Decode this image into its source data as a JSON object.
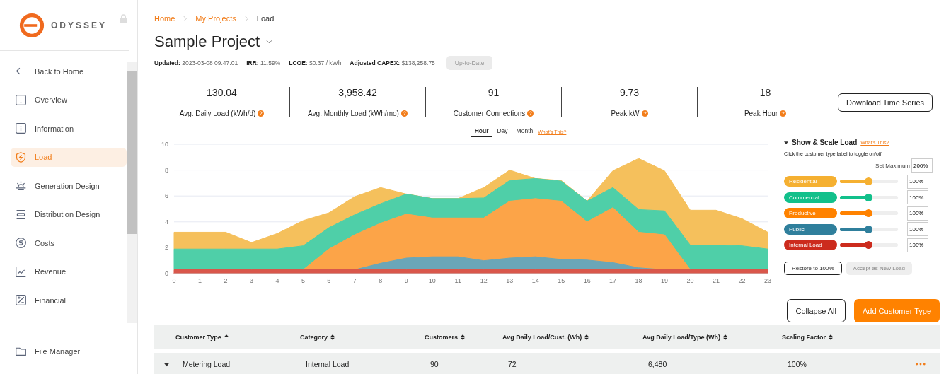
{
  "brand": {
    "name": "ODYSSEY"
  },
  "sidebar": {
    "items": [
      {
        "label": "Back to Home",
        "selected": false
      },
      {
        "label": "Overview",
        "selected": false
      },
      {
        "label": "Information",
        "selected": false
      },
      {
        "label": "Load",
        "selected": true
      },
      {
        "label": "Generation Design",
        "selected": false
      },
      {
        "label": "Distribution Design",
        "selected": false
      },
      {
        "label": "Costs",
        "selected": false
      },
      {
        "label": "Revenue",
        "selected": false
      },
      {
        "label": "Financial",
        "selected": false
      }
    ],
    "footer_item": {
      "label": "File Manager"
    }
  },
  "breadcrumb": [
    {
      "label": "Home",
      "link": true
    },
    {
      "label": "My Projects",
      "link": true
    },
    {
      "label": "Load",
      "link": false
    }
  ],
  "project": {
    "title": "Sample Project",
    "meta": [
      {
        "label": "Updated:",
        "value": "2023-03-08 09:47:01"
      },
      {
        "label": "IRR:",
        "value": "11.59%"
      },
      {
        "label": "LCOE:",
        "value": "$0.37 / kWh"
      },
      {
        "label": "Adjusted CAPEX:",
        "value": "$138,258.75"
      }
    ],
    "status_button": "Up-to-Date"
  },
  "stats": [
    {
      "value": "130.04",
      "label": "Avg. Daily Load (kWh/d)"
    },
    {
      "value": "3,958.42",
      "label": "Avg. Monthly Load (kWh/mo)"
    },
    {
      "value": "91",
      "label": "Customer Connections"
    },
    {
      "value": "9.73",
      "label": "Peak kW"
    },
    {
      "value": "18",
      "label": "Peak Hour"
    }
  ],
  "download_button": "Download Time Series",
  "period_tabs": [
    {
      "label": "Hour",
      "selected": true
    },
    {
      "label": "Day",
      "selected": false
    },
    {
      "label": "Month",
      "selected": false
    }
  ],
  "whats_this": "What's This?",
  "chart": {
    "chart_data": {
      "type": "area",
      "stacked": true,
      "grid": true,
      "xlim": [
        0,
        23
      ],
      "x": [
        0,
        1,
        2,
        3,
        4,
        5,
        6,
        7,
        8,
        9,
        10,
        11,
        12,
        13,
        14,
        15,
        16,
        17,
        18,
        19,
        20,
        21,
        22,
        23
      ],
      "xticks": [
        0,
        1,
        2,
        3,
        4,
        5,
        6,
        7,
        8,
        9,
        10,
        11,
        12,
        13,
        14,
        15,
        16,
        17,
        18,
        19,
        20,
        21,
        22,
        23
      ],
      "ylim": [
        0,
        10
      ],
      "yticks": [
        0,
        2,
        4,
        6,
        8,
        10
      ],
      "series": [
        {
          "color": "#f5c05c",
          "values": [
            1.3,
            1.3,
            1.3,
            0.5,
            1.2,
            1.95,
            1.15,
            1.4,
            1.25,
            0,
            0,
            0,
            0.8,
            0.8,
            0,
            0.05,
            0,
            1.3,
            3.95,
            3.1,
            2.7,
            2.7,
            2.1,
            1.3
          ]
        },
        {
          "color": "#4fcfa8",
          "values": [
            1.6,
            1.6,
            1.6,
            1.6,
            1.6,
            1.85,
            1.65,
            1.55,
            1.5,
            1.55,
            1.5,
            1.5,
            1.55,
            1.6,
            1.55,
            1.55,
            1.6,
            1.55,
            1.75,
            1.85,
            1.9,
            1.9,
            1.85,
            1.6
          ]
        },
        {
          "color": "#fca448",
          "values": [
            0,
            0,
            0,
            0,
            0,
            0,
            1.6,
            2.7,
            3.1,
            3.4,
            3.0,
            3.0,
            3.3,
            4.4,
            4.5,
            4.5,
            2.95,
            4.25,
            2.75,
            2.7,
            0,
            0,
            0,
            0
          ]
        },
        {
          "color": "#6aa6b8",
          "values": [
            0,
            0,
            0,
            0,
            0,
            0,
            0,
            0,
            0.5,
            0.9,
            1.0,
            1.0,
            0.7,
            0.9,
            1.0,
            0.8,
            0.75,
            0.55,
            0.15,
            0,
            0,
            0,
            0,
            0
          ]
        },
        {
          "color": "#d9574b",
          "values": [
            0.3,
            0.3,
            0.3,
            0.3,
            0.3,
            0.3,
            0.3,
            0.3,
            0.3,
            0.3,
            0.3,
            0.3,
            0.3,
            0.3,
            0.3,
            0.3,
            0.3,
            0.3,
            0.3,
            0.3,
            0.3,
            0.3,
            0.3,
            0.3
          ]
        }
      ]
    }
  },
  "scale_panel": {
    "title": "Show & Scale Load",
    "whats_this": "What's This?",
    "hint": "Click the customer type label to toggle on/off",
    "max_label": "Set Maximum",
    "max_value": "200%",
    "types": [
      {
        "name": "Residential",
        "color": "#f5b031",
        "level": 0.5,
        "value": "100%"
      },
      {
        "name": "Commercial",
        "color": "#12c08b",
        "level": 0.5,
        "value": "100%"
      },
      {
        "name": "Productive",
        "color": "#ff8200",
        "level": 0.5,
        "value": "100%"
      },
      {
        "name": "Public",
        "color": "#2f7f9c",
        "level": 0.5,
        "value": "100%"
      },
      {
        "name": "Internal Load",
        "color": "#cc2b1d",
        "level": 0.5,
        "value": "100%"
      }
    ],
    "restore_button": "Restore to 100%",
    "accept_button": {
      "label": "Accept as New Load",
      "disabled": true
    }
  },
  "actions": {
    "collapse": "Collapse All",
    "add": "Add Customer Type"
  },
  "table": {
    "columns": [
      {
        "label": "Customer Type",
        "sorted": true
      },
      {
        "label": "Category",
        "sorted": false
      },
      {
        "label": "Customers",
        "sorted": false
      },
      {
        "label": "Avg Daily Load/Cust. (Wh)",
        "sorted": false
      },
      {
        "label": "Avg Daily Load/Type (Wh)",
        "sorted": false
      },
      {
        "label": "Scaling Factor",
        "sorted": false
      }
    ],
    "rows": [
      {
        "expanded": true,
        "cells": [
          "Metering Load",
          "Internal Load",
          "90",
          "72",
          "6,480",
          "100%"
        ]
      }
    ]
  }
}
